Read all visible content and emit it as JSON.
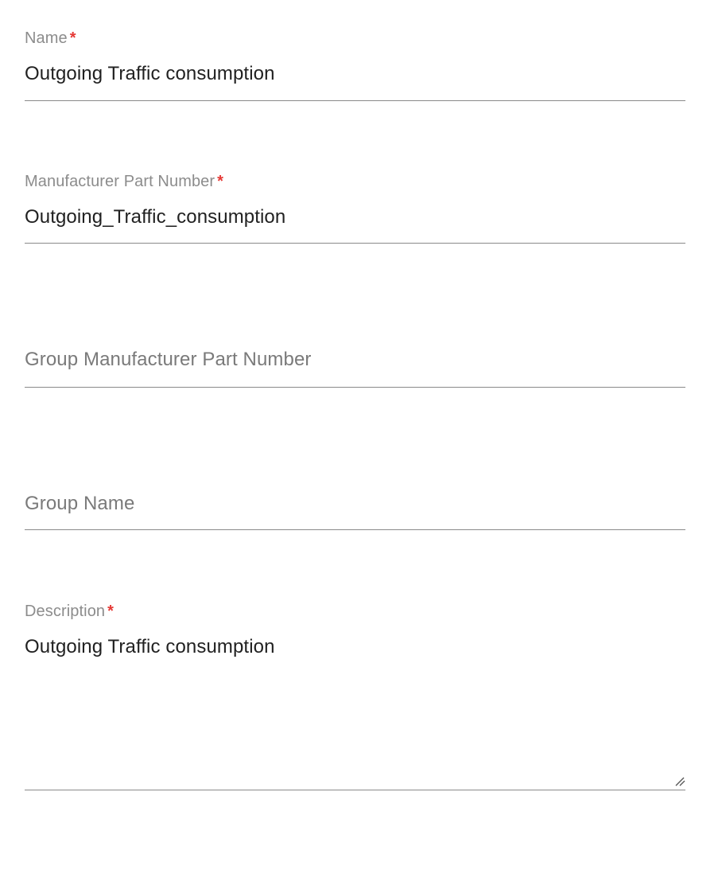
{
  "form": {
    "name": {
      "label": "Name",
      "required_mark": "*",
      "value": "Outgoing Traffic consumption"
    },
    "manufacturer_part_number": {
      "label": "Manufacturer Part Number",
      "required_mark": "*",
      "value": "Outgoing_Traffic_consumption"
    },
    "group_manufacturer_part_number": {
      "placeholder": "Group Manufacturer Part Number",
      "value": ""
    },
    "group_name": {
      "placeholder": "Group Name",
      "value": ""
    },
    "description": {
      "label": "Description",
      "required_mark": "*",
      "value": "Outgoing Traffic consumption",
      "resize_icon": "resize-handle-icon"
    }
  },
  "colors": {
    "required": "#e53935",
    "label": "#8c8c8c",
    "value": "#212121",
    "underline": "#8a8a8a"
  }
}
